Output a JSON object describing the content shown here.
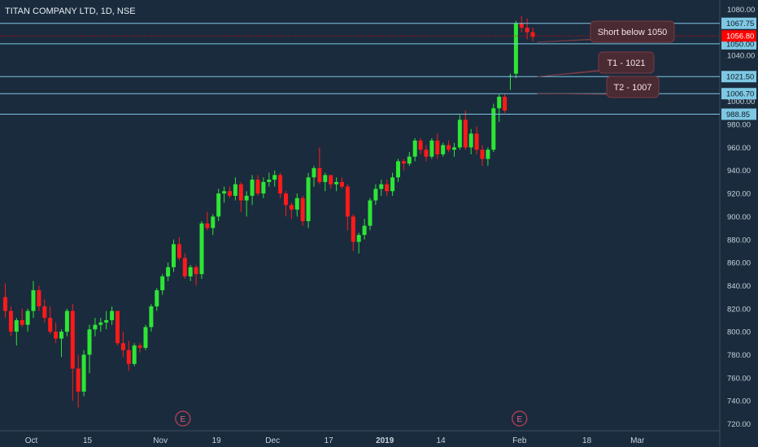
{
  "chart_title": "TITAN COMPANY LTD, 1D, NSE",
  "colors": {
    "background": "#1a2b3d",
    "up": "#2de535",
    "down": "#ff1a1a",
    "hline": "#7ec8e3",
    "price_badge": "#ff0000",
    "callout_bg": "#4a2a33",
    "callout_border": "#7a3a44",
    "text": "#c8d3dc"
  },
  "chart_data": {
    "type": "candlestick",
    "title": "TITAN COMPANY LTD, 1D, NSE",
    "ylim": [
      714,
      1088
    ],
    "y_ticks": [
      720,
      740,
      760,
      780,
      800,
      820,
      840,
      860,
      880,
      900,
      920,
      940,
      960,
      980,
      1000,
      1040,
      1080
    ],
    "y_tick_labels": [
      "720.00",
      "740.00",
      "760.00",
      "780.00",
      "800.00",
      "820.00",
      "840.00",
      "860.00",
      "880.00",
      "900.00",
      "920.00",
      "940.00",
      "960.00",
      "980.00",
      "1000.00",
      "1040.00",
      "1080.00"
    ],
    "x_labels": [
      {
        "label": "Oct",
        "index": 5
      },
      {
        "label": "15",
        "index": 15
      },
      {
        "label": "Nov",
        "index": 28
      },
      {
        "label": "19",
        "index": 38
      },
      {
        "label": "Dec",
        "index": 48
      },
      {
        "label": "17",
        "index": 58
      },
      {
        "label": "2019",
        "index": 68
      },
      {
        "label": "14",
        "index": 78
      },
      {
        "label": "Feb",
        "index": 92
      },
      {
        "label": "18",
        "index": 104
      },
      {
        "label": "Mar",
        "index": 113
      }
    ],
    "x_count": 117,
    "earnings_markers": [
      32,
      92
    ],
    "earnings_label": "E",
    "candles": [
      [
        830,
        842,
        812,
        818
      ],
      [
        818,
        822,
        796,
        800
      ],
      [
        800,
        812,
        788,
        810
      ],
      [
        810,
        820,
        804,
        806
      ],
      [
        806,
        820,
        800,
        818
      ],
      [
        818,
        844,
        812,
        836
      ],
      [
        836,
        840,
        818,
        822
      ],
      [
        822,
        828,
        808,
        812
      ],
      [
        812,
        822,
        798,
        800
      ],
      [
        800,
        808,
        790,
        794
      ],
      [
        794,
        802,
        778,
        800
      ],
      [
        800,
        820,
        796,
        818
      ],
      [
        818,
        824,
        740,
        768
      ],
      [
        768,
        780,
        734,
        748
      ],
      [
        748,
        784,
        744,
        780
      ],
      [
        780,
        806,
        764,
        802
      ],
      [
        802,
        812,
        796,
        806
      ],
      [
        806,
        812,
        800,
        808
      ],
      [
        808,
        818,
        802,
        810
      ],
      [
        810,
        822,
        806,
        818
      ],
      [
        818,
        818,
        788,
        790
      ],
      [
        790,
        800,
        778,
        784
      ],
      [
        784,
        792,
        766,
        772
      ],
      [
        772,
        790,
        770,
        788
      ],
      [
        788,
        790,
        782,
        786
      ],
      [
        786,
        806,
        784,
        804
      ],
      [
        804,
        824,
        800,
        822
      ],
      [
        822,
        838,
        818,
        836
      ],
      [
        836,
        850,
        832,
        848
      ],
      [
        848,
        860,
        844,
        856
      ],
      [
        856,
        880,
        852,
        876
      ],
      [
        876,
        882,
        862,
        864
      ],
      [
        864,
        868,
        846,
        848
      ],
      [
        848,
        858,
        844,
        856
      ],
      [
        856,
        858,
        840,
        850
      ],
      [
        850,
        896,
        846,
        894
      ],
      [
        894,
        904,
        888,
        890
      ],
      [
        890,
        902,
        884,
        900
      ],
      [
        900,
        924,
        896,
        920
      ],
      [
        920,
        926,
        912,
        922
      ],
      [
        922,
        926,
        916,
        918
      ],
      [
        918,
        934,
        914,
        928
      ],
      [
        928,
        930,
        904,
        914
      ],
      [
        914,
        922,
        900,
        918
      ],
      [
        918,
        936,
        910,
        932
      ],
      [
        932,
        936,
        918,
        920
      ],
      [
        920,
        934,
        916,
        930
      ],
      [
        930,
        938,
        926,
        932
      ],
      [
        932,
        940,
        926,
        936
      ],
      [
        936,
        938,
        916,
        920
      ],
      [
        920,
        922,
        900,
        910
      ],
      [
        910,
        912,
        898,
        906
      ],
      [
        906,
        920,
        900,
        916
      ],
      [
        916,
        918,
        892,
        896
      ],
      [
        896,
        938,
        890,
        934
      ],
      [
        934,
        944,
        926,
        942
      ],
      [
        942,
        960,
        928,
        930
      ],
      [
        930,
        938,
        922,
        936
      ],
      [
        936,
        936,
        924,
        928
      ],
      [
        928,
        934,
        922,
        930
      ],
      [
        930,
        934,
        924,
        926
      ],
      [
        926,
        928,
        888,
        900
      ],
      [
        900,
        902,
        870,
        878
      ],
      [
        878,
        886,
        868,
        884
      ],
      [
        884,
        898,
        880,
        892
      ],
      [
        892,
        916,
        888,
        914
      ],
      [
        914,
        928,
        910,
        924
      ],
      [
        924,
        932,
        918,
        928
      ],
      [
        928,
        932,
        918,
        922
      ],
      [
        922,
        938,
        918,
        934
      ],
      [
        934,
        950,
        930,
        948
      ],
      [
        948,
        950,
        940,
        946
      ],
      [
        946,
        956,
        944,
        952
      ],
      [
        952,
        968,
        948,
        966
      ],
      [
        966,
        968,
        954,
        958
      ],
      [
        958,
        962,
        948,
        952
      ],
      [
        952,
        968,
        950,
        966
      ],
      [
        966,
        972,
        950,
        954
      ],
      [
        954,
        964,
        952,
        962
      ],
      [
        962,
        966,
        956,
        958
      ],
      [
        958,
        964,
        952,
        960
      ],
      [
        960,
        988,
        958,
        984
      ],
      [
        984,
        992,
        958,
        960
      ],
      [
        960,
        976,
        954,
        972
      ],
      [
        972,
        978,
        954,
        958
      ],
      [
        958,
        962,
        944,
        950
      ],
      [
        950,
        960,
        944,
        958
      ],
      [
        958,
        998,
        956,
        994
      ],
      [
        994,
        1006,
        982,
        1004
      ],
      [
        1004,
        1006,
        990,
        992
      ],
      [
        1022,
        1024,
        1010,
        1022
      ],
      [
        1024,
        1070,
        1020,
        1068
      ],
      [
        1068,
        1074,
        1060,
        1064
      ],
      [
        1064,
        1072,
        1054,
        1060
      ],
      [
        1060,
        1064,
        1052,
        1056
      ]
    ],
    "hlines": [
      {
        "value": 1067.75,
        "label": "1067.75"
      },
      {
        "value": 1050.0,
        "label": "1050.00"
      },
      {
        "value": 1021.5,
        "label": "1021.50"
      },
      {
        "value": 1006.7,
        "label": "1006.70"
      },
      {
        "value": 988.85,
        "label": "988.85"
      }
    ],
    "current_price": {
      "value": 1056.8,
      "label": "1056.80"
    },
    "annotations": [
      {
        "text": "Short below 1050",
        "target": 1050.0
      },
      {
        "text": "T1 - 1021",
        "target": 1021.5
      },
      {
        "text": "T2 - 1007",
        "target": 1006.7
      }
    ]
  }
}
